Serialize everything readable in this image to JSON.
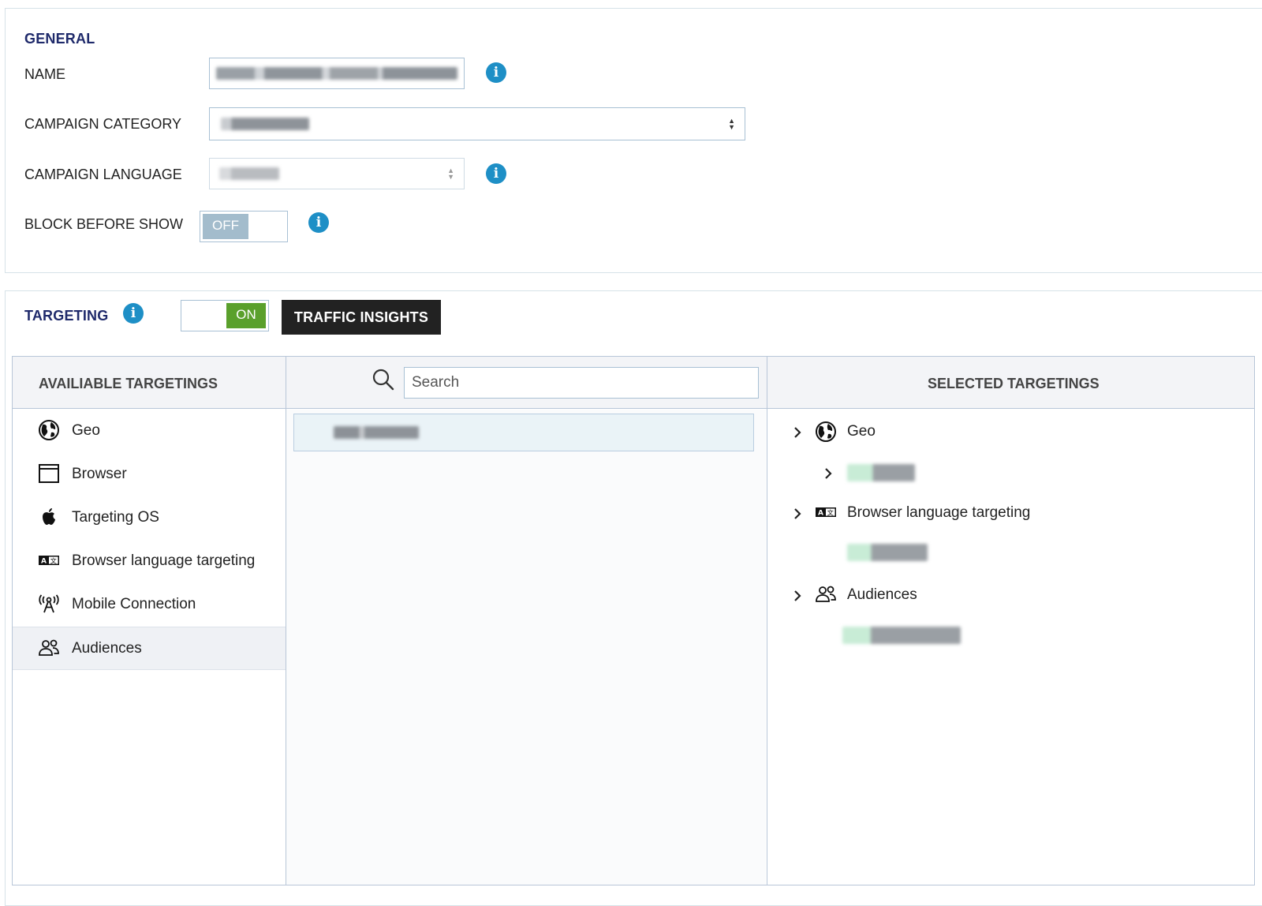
{
  "general": {
    "title": "GENERAL",
    "name_label": "NAME",
    "category_label": "CAMPAIGN CATEGORY",
    "language_label": "CAMPAIGN LANGUAGE",
    "block_label": "BLOCK BEFORE SHOW",
    "block_toggle": "OFF"
  },
  "targeting": {
    "title": "TARGETING",
    "toggle": "ON",
    "traffic_insights": "TRAFFIC INSIGHTS",
    "available_header": "AVAILIABLE TARGETINGS",
    "selected_header": "SELECTED TARGETINGS",
    "search_placeholder": "Search",
    "available": [
      {
        "label": "Geo",
        "icon": "globe-icon"
      },
      {
        "label": "Browser",
        "icon": "browser-window-icon"
      },
      {
        "label": "Targeting OS",
        "icon": "apple-icon"
      },
      {
        "label": "Browser language targeting",
        "icon": "language-icon"
      },
      {
        "label": "Mobile Connection",
        "icon": "antenna-icon"
      },
      {
        "label": "Audiences",
        "icon": "people-icon"
      }
    ],
    "selected": [
      {
        "label": "Geo",
        "icon": "globe-icon"
      },
      {
        "label": "Browser language targeting",
        "icon": "language-icon"
      },
      {
        "label": "Audiences",
        "icon": "people-icon"
      }
    ]
  },
  "colors": {
    "section_title": "#1f2a6b",
    "info": "#1e8fc6",
    "toggle_on": "#5aa02c",
    "toggle_off": "#a3bccc"
  }
}
